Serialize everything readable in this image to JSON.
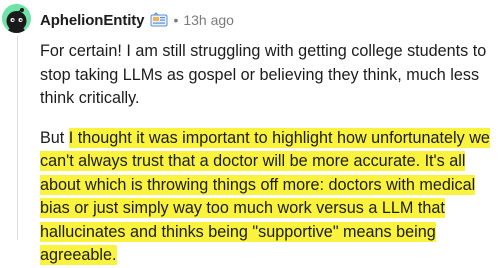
{
  "comment": {
    "username": "AphelionEntity",
    "separator": "•",
    "timestamp": "13h ago",
    "icons": {
      "avatar": "snoo-avatar-icon",
      "badge": "user-flair-badge-icon"
    },
    "colors": {
      "avatar_bg": "#6fe2a8",
      "highlight": "#f9f33e",
      "meta_text": "#7a7a7a"
    },
    "paragraph1": "For certain! I am still struggling with getting college students to stop taking LLMs as gospel or believing they think, much less think critically.",
    "paragraph2_lead": "But ",
    "paragraph2_highlighted": "I thought it was important to highlight how unfortunately we can't always trust that a doctor will be more accurate. It's all about which is throwing things off more: doctors with medical bias or just simply way too much work versus a LLM that hallucinates and thinks being \"supportive\" means being agreeable."
  }
}
